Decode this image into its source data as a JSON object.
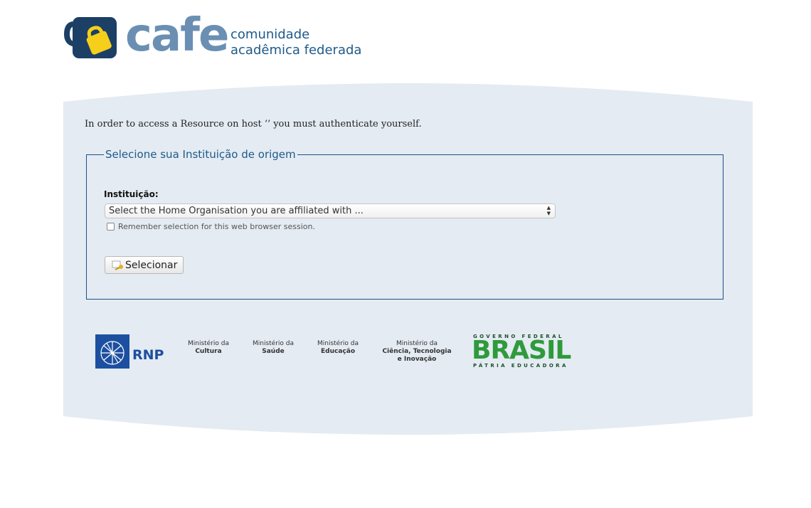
{
  "logo": {
    "wordmark": "cafe",
    "tagline_line1": "comunidade",
    "tagline_line2": "acadêmica federada"
  },
  "intro_text": "In order to access a Resource on host ‘’ you must authenticate yourself.",
  "fieldset": {
    "legend": "Selecione sua Instituição de origem",
    "institution_label": "Instituição:",
    "select_value": "Select the Home Organisation you are affiliated with ...",
    "remember_label": "Remember selection for this web browser session.",
    "remember_checked": false,
    "submit_label": "Selecionar"
  },
  "footer": {
    "rnp": "RNP",
    "ministries": [
      {
        "line1": "Ministério da",
        "line2": "Cultura",
        "line3": ""
      },
      {
        "line1": "Ministério da",
        "line2": "Saúde",
        "line3": ""
      },
      {
        "line1": "Ministério da",
        "line2": "Educação",
        "line3": ""
      },
      {
        "line1": "Ministério da",
        "line2": "Ciência, Tecnologia",
        "line3": "e Inovação"
      }
    ],
    "gov_top": "GOVERNO FEDERAL",
    "gov_word": "BRASIL",
    "gov_bottom": "PÁTRIA EDUCADORA"
  },
  "colors": {
    "brand_blue": "#1e5a8a",
    "panel_bg": "#e4ebf2",
    "brand_yellow": "#f5cf1a"
  }
}
